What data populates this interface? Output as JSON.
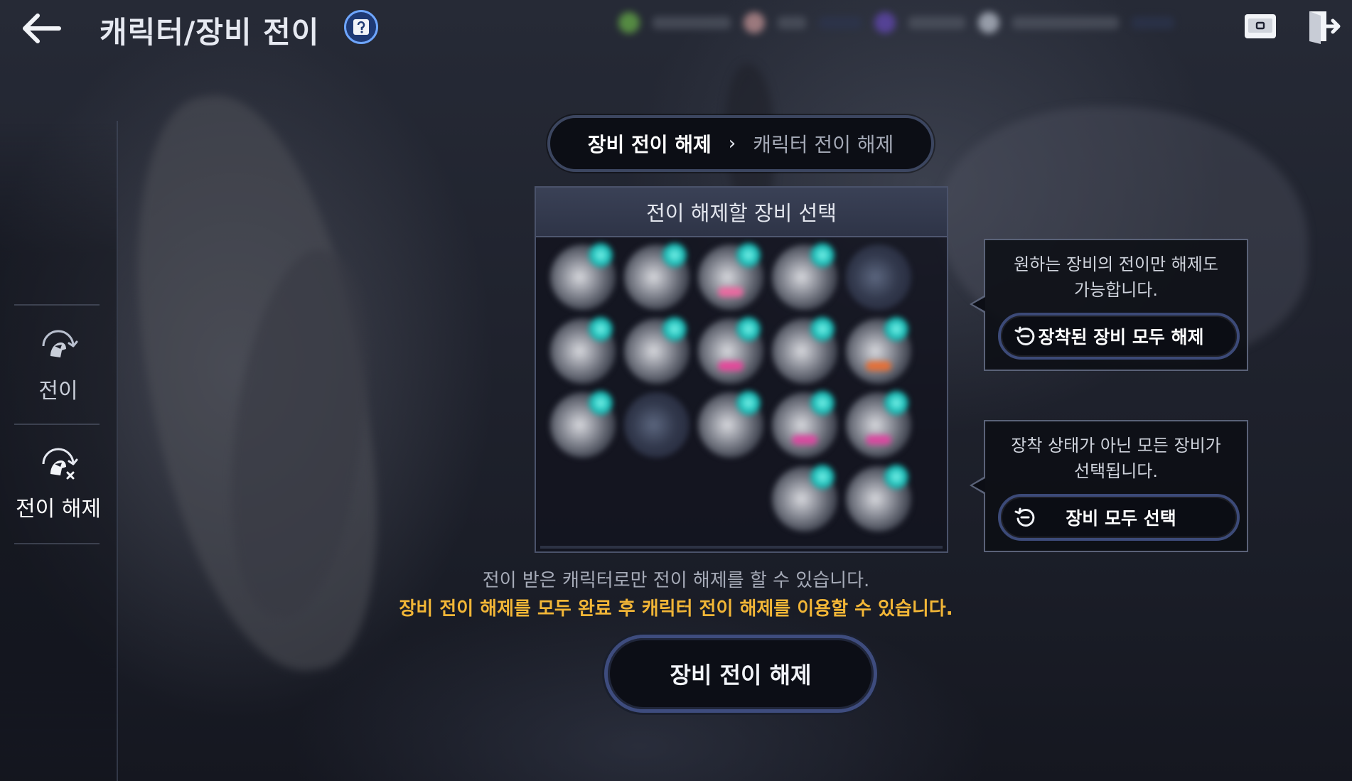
{
  "header": {
    "title": "캐릭터/장비 전이"
  },
  "sidebar": {
    "items": [
      {
        "label": "전이",
        "active": false
      },
      {
        "label": "전이 해제",
        "active": true
      }
    ]
  },
  "steps": {
    "current": "장비 전이 해제",
    "next": "캐릭터 전이 해제"
  },
  "equipment_panel": {
    "title": "전이 해제할 장비 선택"
  },
  "info_boxes": [
    {
      "lines": [
        "원하는 장비의 전이만 해제도",
        "가능합니다."
      ],
      "button_label": "장착된 장비 모두 해제"
    },
    {
      "lines": [
        "장착 상태가 아닌 모든 장비가",
        "선택됩니다."
      ],
      "button_label": "장비 모두 선택"
    }
  ],
  "notices": {
    "info": "전이 받은 캐릭터로만 전이 해제를 할 수 있습니다.",
    "warning": "장비 전이 해제를 모두 완료 후 캐릭터 전이 해제를 이용할 수 있습니다."
  },
  "main_action": {
    "label": "장비 전이 해제"
  },
  "colors": {
    "accent_gold": "#f2b637",
    "button_border": "#3e4c7e",
    "gem_teal": "#18b8b3"
  }
}
